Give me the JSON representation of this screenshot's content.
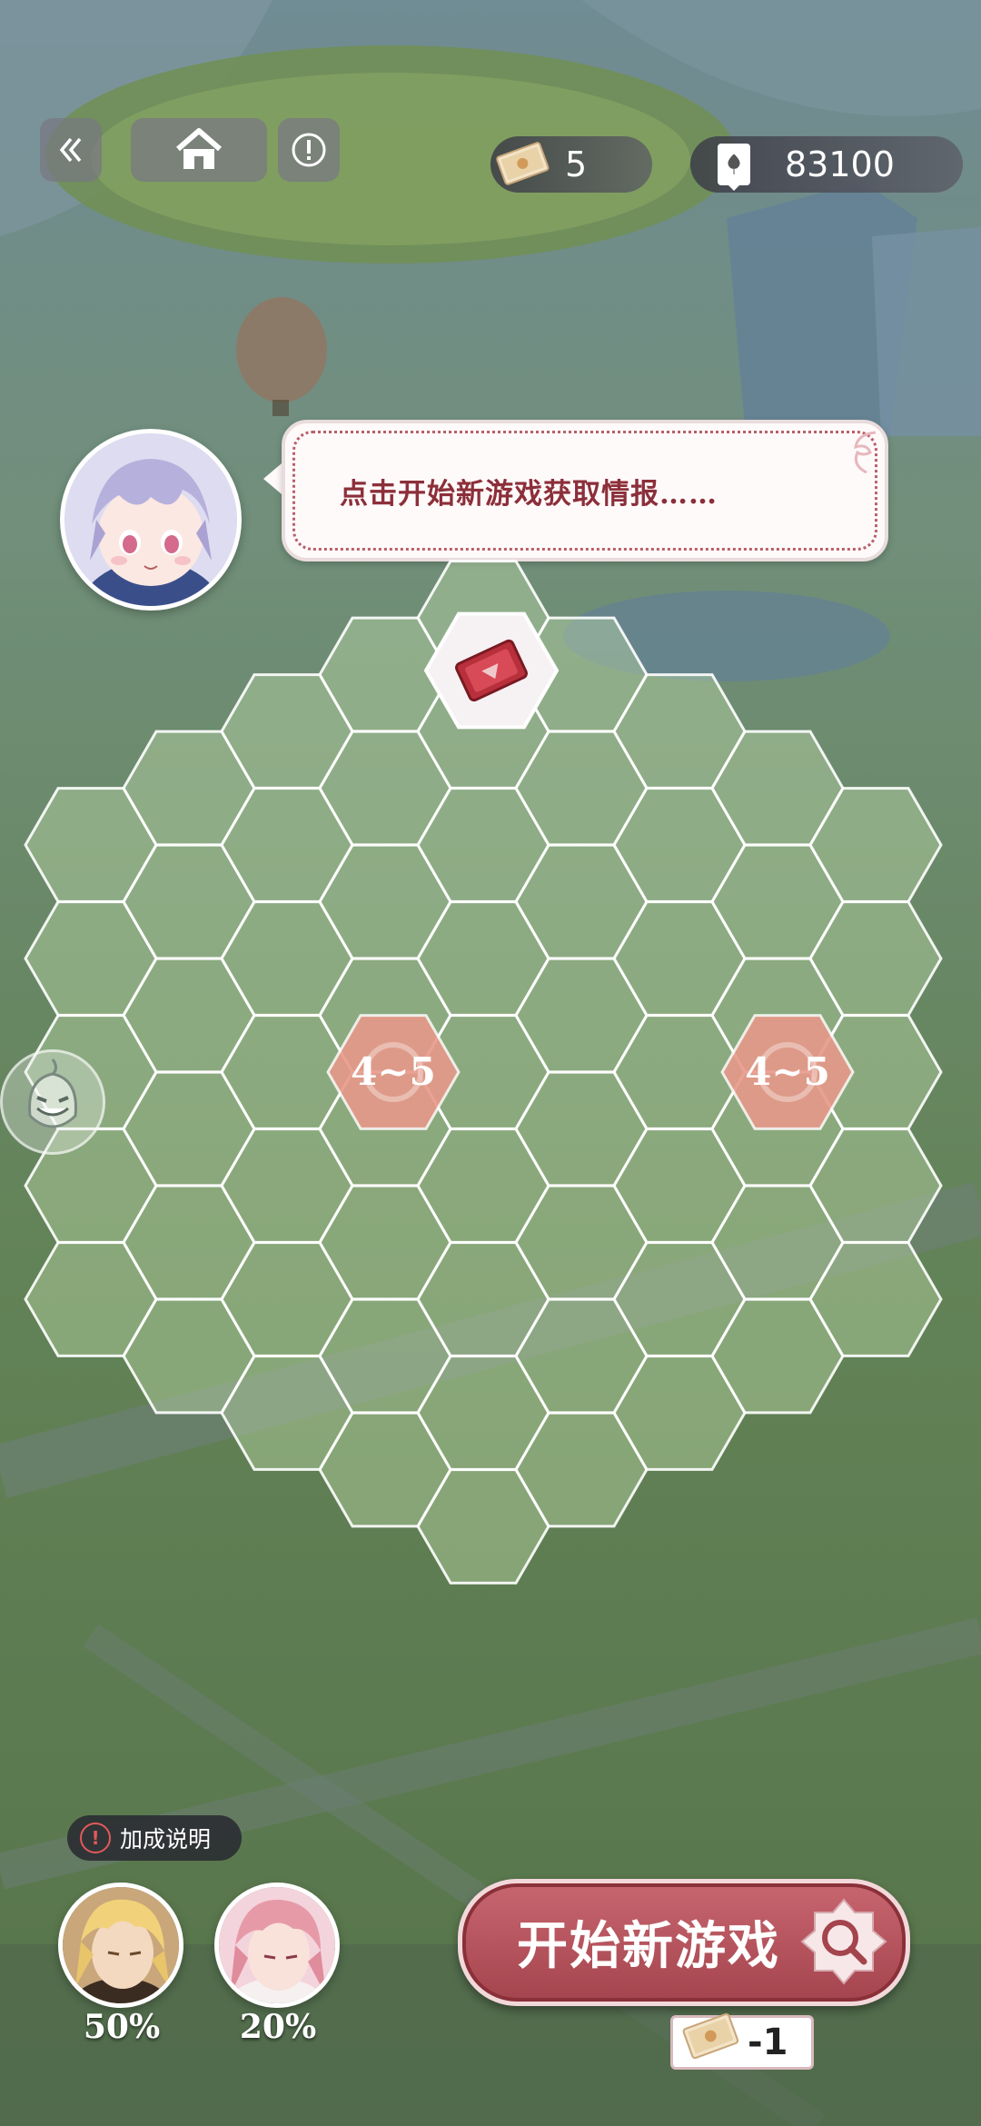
{
  "colors": {
    "accent": "#a4444d",
    "bubble_text": "#8c2f3a",
    "range_hex": "#e8998a"
  },
  "header": {
    "back_icon": "double-chevron-left-icon",
    "home_icon": "home-icon",
    "info_icon": "info-icon",
    "tickets_icon": "ticket-icon",
    "tickets_count": "5",
    "cards_icon": "card-icon",
    "cards_count": "83100"
  },
  "dialog": {
    "avatar_icon": "character-portrait",
    "text": "点击开始新游戏获取情报……"
  },
  "board": {
    "top_item_icon": "red-card-icon",
    "range_markers": [
      {
        "label": "4~5"
      },
      {
        "label": "4~5"
      }
    ]
  },
  "side": {
    "icon": "grinning-ghost-icon"
  },
  "bonus": {
    "label": "加成说明",
    "characters": [
      {
        "icon": "blonde-character-portrait",
        "percent": "50%"
      },
      {
        "icon": "pink-hair-character-portrait",
        "percent": "20%"
      }
    ]
  },
  "start": {
    "label": "开始新游戏",
    "icon": "search-icon",
    "cost_icon": "ticket-icon",
    "cost": "-1"
  }
}
